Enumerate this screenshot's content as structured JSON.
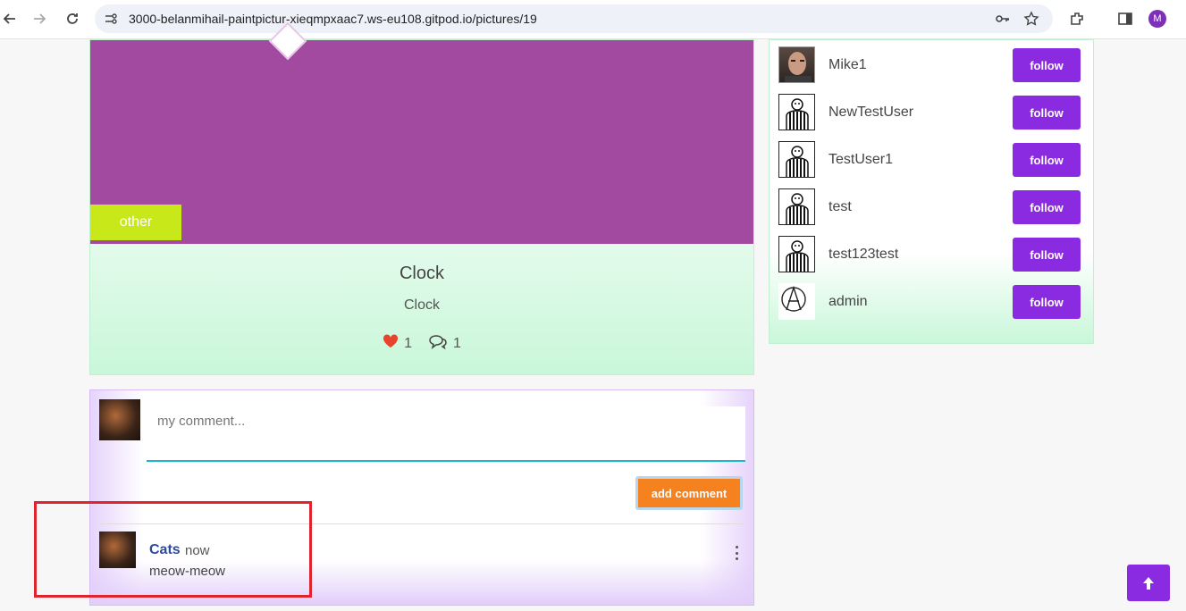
{
  "browser": {
    "url": "3000-belanmihail-paintpictur-xieqmpxaac7.ws-eu108.gitpod.io/pictures/19",
    "profile_initial": "M"
  },
  "post": {
    "category": "other",
    "title": "Clock",
    "description": "Clock",
    "likes": "1",
    "comments": "1",
    "image_color": "#a14aa0"
  },
  "users": [
    {
      "name": "Mike1",
      "avatar": "photo-avatar",
      "follow_label": "follow"
    },
    {
      "name": "NewTestUser",
      "avatar": "default-avatar",
      "follow_label": "follow"
    },
    {
      "name": "TestUser1",
      "avatar": "default-avatar",
      "follow_label": "follow"
    },
    {
      "name": "test",
      "avatar": "default-avatar",
      "follow_label": "follow"
    },
    {
      "name": "test123test",
      "avatar": "default-avatar",
      "follow_label": "follow"
    },
    {
      "name": "admin",
      "avatar": "anarchy-avatar",
      "follow_label": "follow"
    }
  ],
  "comment_form": {
    "placeholder": "my comment...",
    "submit_label": "add comment"
  },
  "comments": [
    {
      "author": "Cats",
      "time": "now",
      "text": "meow-meow"
    }
  ],
  "colors": {
    "accent_purple": "#8a2be2",
    "category_green": "#c8e81a",
    "submit_orange": "#f5821f",
    "author_blue": "#2d4a9a"
  }
}
